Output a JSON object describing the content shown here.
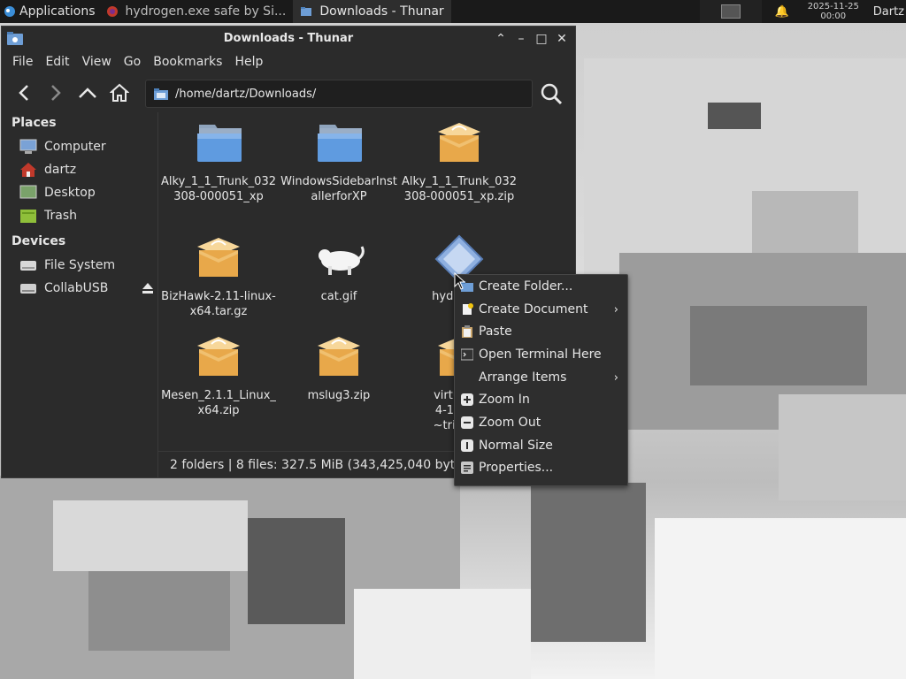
{
  "panel": {
    "apps_label": "Applications",
    "tasks": [
      {
        "label": "hydrogen.exe safe by Si...",
        "icon": "firefox-icon",
        "active": false
      },
      {
        "label": "Downloads - Thunar",
        "icon": "folder-icon",
        "active": true
      }
    ],
    "clock_date": "2025-11-25",
    "clock_time": "00:00",
    "user": "Dartz"
  },
  "window": {
    "title": "Downloads - Thunar",
    "menu": [
      "File",
      "Edit",
      "View",
      "Go",
      "Bookmarks",
      "Help"
    ],
    "location": "/home/dartz/Downloads/"
  },
  "sidebar": {
    "places_header": "Places",
    "places": [
      {
        "label": "Computer",
        "icon": "computer-icon"
      },
      {
        "label": "dartz",
        "icon": "home-icon"
      },
      {
        "label": "Desktop",
        "icon": "desktop-icon"
      },
      {
        "label": "Trash",
        "icon": "trash-icon"
      }
    ],
    "devices_header": "Devices",
    "devices": [
      {
        "label": "File System",
        "icon": "drive-icon"
      },
      {
        "label": "CollabUSB",
        "icon": "usb-drive-icon"
      }
    ]
  },
  "files": [
    {
      "name": "Alky_1_1_Trunk_032308-000051_xp",
      "type": "folder"
    },
    {
      "name": "WindowsSidebarInstallerforXP",
      "type": "folder"
    },
    {
      "name": "Alky_1_1_Trunk_032308-000051_xp.zip",
      "type": "archive"
    },
    {
      "name": "BizHawk-2.11-linux-x64.tar.gz",
      "type": "archive"
    },
    {
      "name": "cat.gif",
      "type": "image"
    },
    {
      "name": "hydrogen",
      "type": "executable",
      "visible_suffix": "e"
    },
    {
      "name": "Mesen_2.1.1_Linux_x64.zip",
      "type": "archive"
    },
    {
      "name": "mslug3.zip",
      "type": "archive"
    },
    {
      "name": "virtualbo",
      "type": "archive",
      "line2": "4-17099",
      "line3": "~trixie_a"
    }
  ],
  "status": "2 folders  |  8 files: 327.5 MiB (343,425,040 bytes)",
  "context_menu": [
    {
      "label": "Create Folder...",
      "icon": "new-folder-icon",
      "submenu": false
    },
    {
      "label": "Create Document",
      "icon": "new-document-icon",
      "submenu": true
    },
    {
      "label": "Paste",
      "icon": "paste-icon",
      "submenu": false
    },
    {
      "label": "Open Terminal Here",
      "icon": "terminal-icon",
      "submenu": false
    },
    {
      "label": "Arrange Items",
      "icon": "",
      "submenu": true
    },
    {
      "label": "Zoom In",
      "icon": "zoom-in-icon",
      "submenu": false
    },
    {
      "label": "Zoom Out",
      "icon": "zoom-out-icon",
      "submenu": false
    },
    {
      "label": "Normal Size",
      "icon": "normal-size-icon",
      "submenu": false
    },
    {
      "label": "Properties...",
      "icon": "properties-icon",
      "submenu": false
    }
  ]
}
